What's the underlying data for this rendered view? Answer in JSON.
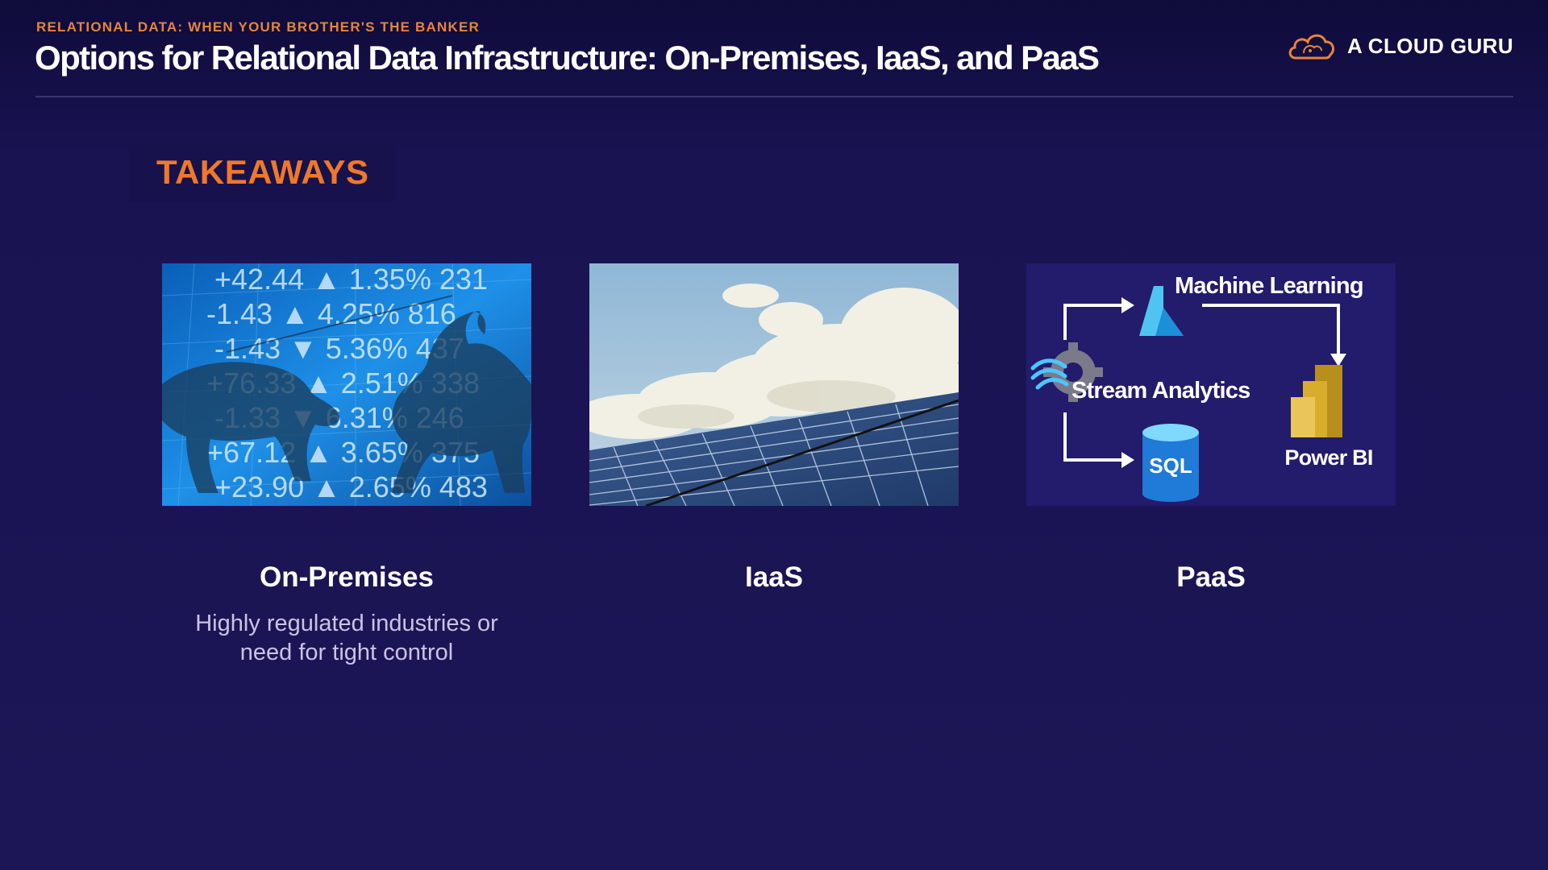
{
  "header": {
    "eyebrow": "RELATIONAL DATA: WHEN YOUR BROTHER'S THE BANKER",
    "title": "Options for Relational Data Infrastructure: On-Premises, IaaS, and PaaS"
  },
  "brand": {
    "name": "A CLOUD GURU",
    "logo_icon": "cloud-icon"
  },
  "section": {
    "label": "TAKEAWAYS"
  },
  "cards": [
    {
      "caption": "On-Premises",
      "description_lines": [
        "Highly regulated industries or",
        "need for tight control"
      ],
      "image": {
        "name": "stock-market-bull-bear-image",
        "ticker_lines": [
          "+42.44 ▲ 1.35% 231",
          "-1.43 ▲ 4.25% 816",
          "-1.43 ▼ 5.36% 437",
          "+76.33 ▲ 2.51% 338",
          "-1.33 ▼ 6.31% 246",
          "+67.12 ▲ 3.65% 375",
          "+23.90 ▲ 2.65% 483"
        ]
      }
    },
    {
      "caption": "IaaS",
      "description_lines": [],
      "image": {
        "name": "solar-panels-clouds-image"
      }
    },
    {
      "caption": "PaaS",
      "description_lines": [],
      "image": {
        "name": "paas-services-diagram-image",
        "labels": {
          "machine_learning": "Machine Learning",
          "stream_analytics": "Stream Analytics",
          "sql": "SQL",
          "power_bi": "Power BI"
        }
      }
    }
  ],
  "colors": {
    "accent_orange": "#f0782a",
    "eyebrow_orange": "#e8843a",
    "background": "#1c1656"
  }
}
